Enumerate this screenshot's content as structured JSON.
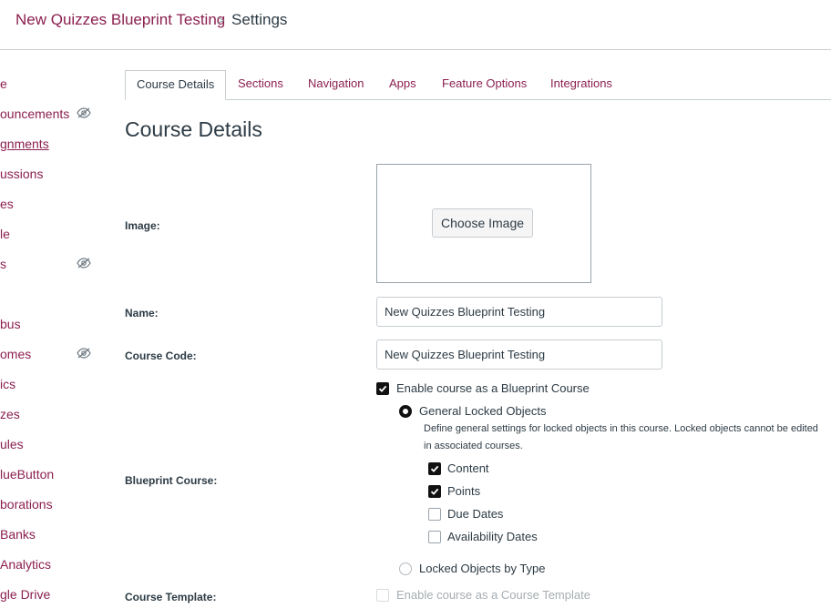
{
  "breadcrumb": {
    "course": "New Quizzes Blueprint Testing",
    "separator": ">",
    "current": "Settings"
  },
  "nav": {
    "items": [
      {
        "label": "e"
      },
      {
        "label": "ouncements"
      },
      {
        "label": "gnments"
      },
      {
        "label": "ussions"
      },
      {
        "label": "es"
      },
      {
        "label": "le"
      },
      {
        "label": "s"
      },
      {
        "label": "bus"
      },
      {
        "label": "omes"
      },
      {
        "label": "ics"
      },
      {
        "label": "zes"
      },
      {
        "label": "ules"
      },
      {
        "label": "lueButton"
      },
      {
        "label": "borations"
      },
      {
        "label": "Banks"
      },
      {
        "label": "Analytics"
      },
      {
        "label": "gle Drive"
      }
    ],
    "hidden_icon": "eye-slash-icon"
  },
  "tabs": [
    {
      "label": "Course Details"
    },
    {
      "label": "Sections"
    },
    {
      "label": "Navigation"
    },
    {
      "label": "Apps"
    },
    {
      "label": "Feature Options"
    },
    {
      "label": "Integrations"
    }
  ],
  "page_title": "Course Details",
  "form": {
    "image_label": "Image:",
    "choose_image": "Choose Image",
    "name_label": "Name:",
    "name_value": "New Quizzes Blueprint Testing",
    "course_code_label": "Course Code:",
    "course_code_value": "New Quizzes Blueprint Testing",
    "blueprint_label": "Blueprint Course:",
    "enable_blueprint": "Enable course as a Blueprint Course",
    "general_locked": "General Locked Objects",
    "general_help": "Define general settings for locked objects in this course. Locked objects cannot be edited in associated courses.",
    "options": [
      {
        "label": "Content",
        "checked": true
      },
      {
        "label": "Points",
        "checked": true
      },
      {
        "label": "Due Dates",
        "checked": false
      },
      {
        "label": "Availability Dates",
        "checked": false
      }
    ],
    "locked_by_type": "Locked Objects by Type",
    "template_label": "Course Template:",
    "enable_template": "Enable course as a Course Template"
  },
  "colors": {
    "link": "#8b1f4f",
    "text": "#2d3b45",
    "border": "#c7cdd1"
  }
}
